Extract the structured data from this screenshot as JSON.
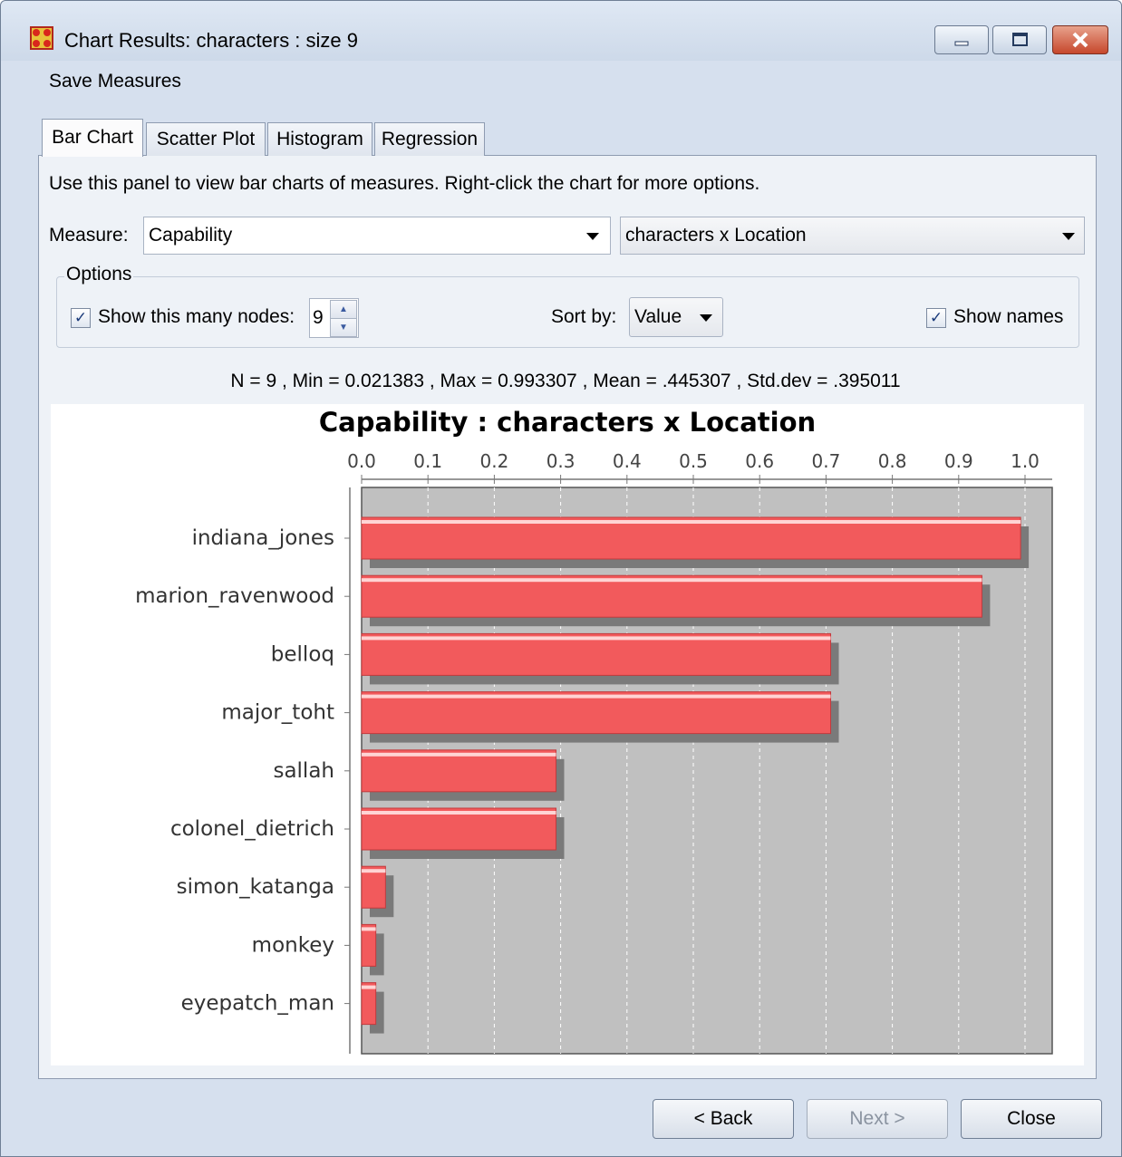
{
  "window": {
    "title": "Chart Results: characters : size 9"
  },
  "menu": {
    "save_label": "Save Measures"
  },
  "tabs": [
    {
      "label": "Bar Chart",
      "active": true
    },
    {
      "label": "Scatter Plot",
      "active": false
    },
    {
      "label": "Histogram",
      "active": false
    },
    {
      "label": "Regression",
      "active": false
    }
  ],
  "panel": {
    "info": "Use this panel to view bar charts of measures. Right-click the chart for more options.",
    "measure_label": "Measure:",
    "measure_value": "Capability",
    "network_value": "characters x Location",
    "options_title": "Options",
    "show_nodes_label": "Show this many nodes:",
    "show_nodes_checked": true,
    "node_count": "9",
    "sort_label": "Sort by:",
    "sort_value": "Value",
    "show_names_label": "Show names",
    "show_names_checked": true,
    "stats": "N = 9 , Min = 0.021383 , Max = 0.993307 , Mean = .445307 , Std.dev = .395011"
  },
  "chart_data": {
    "type": "bar",
    "orientation": "horizontal",
    "title": "Capability : characters x Location",
    "categories": [
      "indiana_jones",
      "marion_ravenwood",
      "belloq",
      "major_toht",
      "sallah",
      "colonel_dietrich",
      "simon_katanga",
      "monkey",
      "eyepatch_man"
    ],
    "values": [
      0.993307,
      0.935,
      0.707,
      0.707,
      0.293,
      0.293,
      0.036,
      0.021383,
      0.021383
    ],
    "xlim": [
      0,
      1.0
    ],
    "ticks": [
      "0.0",
      "0.1",
      "0.2",
      "0.3",
      "0.4",
      "0.5",
      "0.6",
      "0.7",
      "0.8",
      "0.9",
      "1.0"
    ],
    "axis_position": "top",
    "grid": true,
    "bar_color": "#f25a5c",
    "plot_background": "#c0c0c0"
  },
  "buttons": {
    "back": "< Back",
    "next": "Next >",
    "close": "Close"
  },
  "colors": {
    "window_bg": "#d6e0ee",
    "panel_bg": "#eef2f7"
  }
}
